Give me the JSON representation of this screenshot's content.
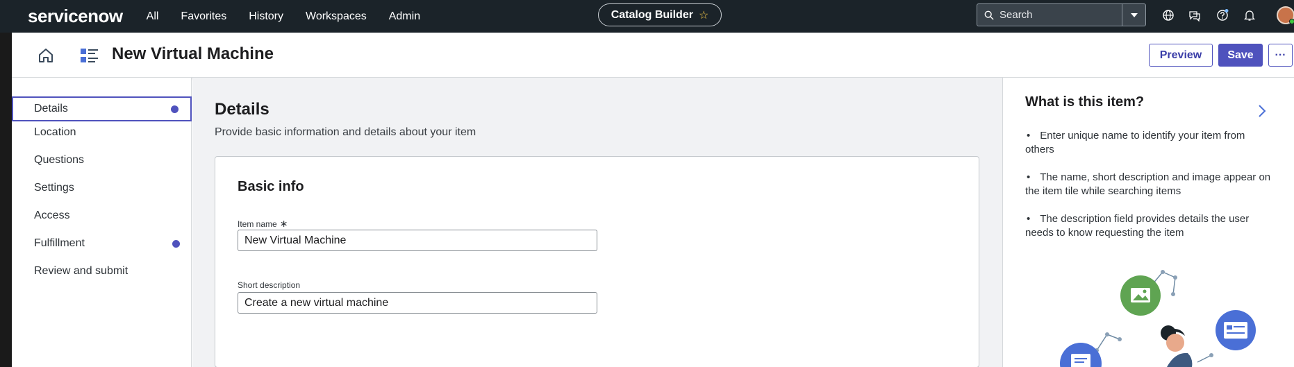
{
  "topbar": {
    "logo": "servicenow",
    "nav": [
      "All",
      "Favorites",
      "History",
      "Workspaces",
      "Admin"
    ],
    "context_pill": "Catalog Builder",
    "search_placeholder": "Search",
    "icons": [
      "globe-icon",
      "chat-icon",
      "help-icon",
      "bell-icon",
      "user-avatar"
    ]
  },
  "header": {
    "title": "New Virtual Machine",
    "preview_label": "Preview",
    "save_label": "Save",
    "more_label": "···"
  },
  "steps": [
    {
      "label": "Details",
      "active": true,
      "dot": true
    },
    {
      "label": "Location",
      "active": false,
      "dot": false
    },
    {
      "label": "Questions",
      "active": false,
      "dot": false
    },
    {
      "label": "Settings",
      "active": false,
      "dot": false
    },
    {
      "label": "Access",
      "active": false,
      "dot": false
    },
    {
      "label": "Fulfillment",
      "active": false,
      "dot": true
    },
    {
      "label": "Review and submit",
      "active": false,
      "dot": false
    }
  ],
  "main": {
    "title": "Details",
    "subtitle": "Provide basic information and details about your item",
    "card": {
      "title": "Basic info",
      "item_name_label": "Item name",
      "item_name_value": "New Virtual Machine",
      "short_desc_label": "Short description",
      "short_desc_value": "Create a new virtual machine"
    }
  },
  "help": {
    "title": "What is this item?",
    "items": [
      "Enter unique name to identify your item from others",
      "The name, short description and image appear on the item tile while searching items",
      "The description field provides details the user needs to know requesting the item"
    ]
  },
  "colors": {
    "topbar": "#1b2329",
    "accent": "#4f52bd",
    "illus_green": "#5fa452",
    "illus_blue": "#4a6fd6"
  }
}
